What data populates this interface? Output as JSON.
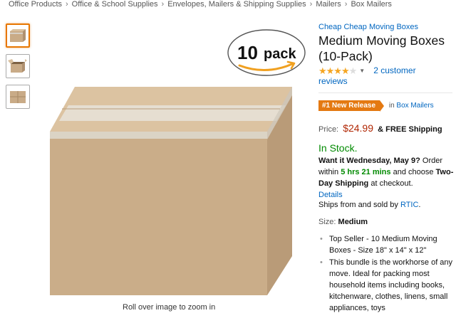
{
  "breadcrumb": [
    "Office Products",
    "Office & School Supplies",
    "Envelopes, Mailers & Shipping Supplies",
    "Mailers",
    "Box Mailers"
  ],
  "breadcrumb_sep": "›",
  "image": {
    "badge_number": "10",
    "badge_word": "pack",
    "zoom_hint": "Roll over image to zoom in"
  },
  "product": {
    "brand": "Cheap Cheap Moving Boxes",
    "title": "Medium Moving Boxes (10-Pack)",
    "rating_stars": 4,
    "reviews_count": "2",
    "reviews_word": "customer",
    "reviews_word2": "reviews",
    "badge_label": "#1 New Release",
    "badge_in": "in",
    "badge_category": "Box Mailers",
    "price_label": "Price:",
    "price": "$24.99",
    "shipping_amp": "&",
    "shipping_text": "FREE Shipping",
    "stock": "In Stock.",
    "delivery_prefix": "Want it Wednesday, May 9?",
    "delivery_order": "Order within",
    "delivery_timer": "5 hrs 21 mins",
    "delivery_choose": "and choose",
    "delivery_option": "Two-Day Shipping",
    "delivery_suffix": "at checkout.",
    "details_link": "Details",
    "ships_text": "Ships from and sold by",
    "seller": "RTIC",
    "seller_end": ".",
    "size_label": "Size:",
    "size_value": "Medium",
    "bullets": [
      "Top Seller - 10 Medium Moving Boxes - Size 18\" x 14\" x 12\"",
      "This bundle is the workhorse of any move. Ideal for packing most household items including books, kitchenware, clothes, linens, small appliances, toys"
    ]
  },
  "colors": {
    "link": "#0066c0",
    "price": "#b12704",
    "in_stock": "#008a00",
    "badge": "#e47911",
    "cardboard": "#c9ab87"
  }
}
